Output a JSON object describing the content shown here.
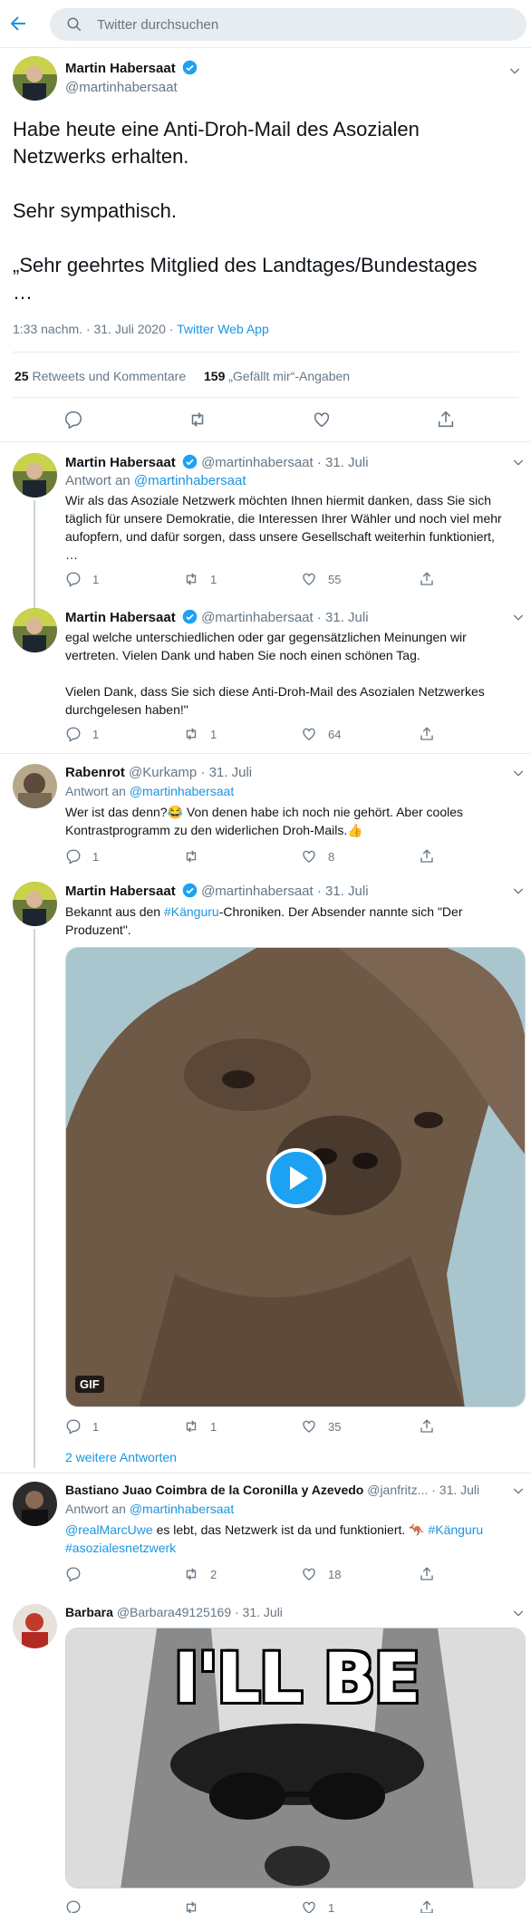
{
  "search": {
    "placeholder": "Twitter durchsuchen"
  },
  "main_tweet": {
    "name": "Martin Habersaat",
    "handle": "@martinhabersaat",
    "text_line1": "Habe heute eine Anti-Droh-Mail des Asozialen",
    "text_line2": "Netzwerks erhalten.",
    "text_line3": "Sehr sympathisch.",
    "text_line4": "„Sehr geehrtes Mitglied des Landtages/Bundestages",
    "text_line5": "…",
    "time": "1:33 nachm. · 31. Juli 2020 · ",
    "source": "Twitter Web App",
    "retweets_count": "25",
    "retweets_label": "Retweets und Kommentare",
    "likes_count": "159",
    "likes_label": "„Gefällt mir“-Angaben"
  },
  "replies": [
    {
      "name": "Martin Habersaat",
      "handle": "@martinhabersaat · 31. Juli",
      "reply_to_prefix": "Antwort an ",
      "reply_to": "@martinhabersaat",
      "lines": [
        "Wir als das Asoziale Netzwerk möchten Ihnen hiermit danken, dass Sie sich",
        "täglich für unsere Demokratie, die Interessen Ihrer Wähler und noch viel mehr",
        "aufopfern, und dafür sorgen, dass unsere Gesellschaft weiterhin funktioniert,",
        "…"
      ],
      "reply_count": "1",
      "retweet_count": "1",
      "like_count": "55"
    },
    {
      "name": "Martin Habersaat",
      "handle": "@martinhabersaat · 31. Juli",
      "lines": [
        "egal welche unterschiedlichen oder gar gegensätzlichen Meinungen wir",
        "vertreten. Vielen Dank und haben Sie noch einen schönen Tag.",
        "",
        "Vielen Dank, dass Sie sich diese Anti-Droh-Mail des Asozialen Netzwerkes",
        "durchgelesen haben!\""
      ],
      "reply_count": "1",
      "retweet_count": "1",
      "like_count": "64"
    },
    {
      "name": "Rabenrot",
      "handle": "@Kurkamp · 31. Juli",
      "reply_to_prefix": "Antwort an ",
      "reply_to": "@martinhabersaat",
      "lines": [
        "Wer ist das denn?😂 Von denen habe ich noch nie gehört. Aber cooles",
        "Kontrastprogramm zu den widerlichen Droh-Mails.👍"
      ],
      "reply_count": "1",
      "retweet_count": "",
      "like_count": "8"
    },
    {
      "name": "Martin Habersaat",
      "handle": "@martinhabersaat · 31. Juli",
      "line1_a": "Bekannt aus den ",
      "line1_tag": "#Känguru",
      "line1_b": "-Chroniken. Der Absender nannte sich \"Der",
      "line2": "Produzent\".",
      "gif_label": "GIF",
      "reply_count": "1",
      "retweet_count": "1",
      "like_count": "35",
      "more_replies": "2 weitere Antworten"
    },
    {
      "name": "Bastiano Juao Coimbra de la Coronilla y Azevedo",
      "handle": "@janfritz... · 31. Juli",
      "reply_to_prefix": "Antwort an ",
      "reply_to": "@martinhabersaat",
      "mention": "@realMarcUwe",
      "text_a": " es lebt, das Netzwerk ist da und funktioniert. 🦘 ",
      "tag1": "#Känguru",
      "tag2": "#asozialesnetzwerk",
      "reply_count": "",
      "retweet_count": "2",
      "like_count": "18"
    },
    {
      "name": "Barbara",
      "handle": "@Barbara49125169 · 31. Juli",
      "meme_text": "I'LL BE",
      "reply_count": "",
      "retweet_count": "",
      "like_count": "1"
    }
  ],
  "colors": {
    "accent": "#1b95e0",
    "muted": "#657786",
    "border": "#e6ecf0",
    "verified": "#1da1f2"
  }
}
